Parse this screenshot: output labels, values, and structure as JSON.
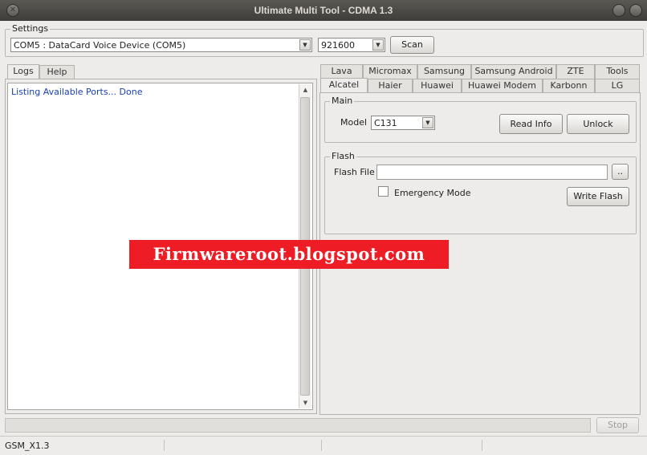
{
  "window": {
    "title": "Ultimate Multi Tool - CDMA 1.3"
  },
  "settings": {
    "group_label": "Settings",
    "port_value": "COM5 : DataCard Voice Device (COM5)",
    "baud_value": "921600",
    "scan_label": "Scan"
  },
  "left_tabs": {
    "logs": "Logs",
    "help": "Help"
  },
  "log": {
    "line1": "Listing Available Ports... Done"
  },
  "brand_tabs": {
    "row1": [
      "Lava",
      "Micromax",
      "Samsung",
      "Samsung Android",
      "ZTE",
      "Tools"
    ],
    "row2": [
      "Alcatel",
      "Haier",
      "Huawei",
      "Huawei Modem",
      "Karbonn",
      "LG"
    ],
    "active": "Alcatel"
  },
  "main": {
    "group_label": "Main",
    "model_label": "Model",
    "model_value": "C131",
    "read_info_label": "Read Info",
    "unlock_label": "Unlock"
  },
  "flash": {
    "group_label": "Flash",
    "file_label": "Flash File",
    "file_value": "",
    "browse_label": "..",
    "emergency_label": "Emergency Mode",
    "emergency_checked": false,
    "write_label": "Write Flash"
  },
  "progress": {
    "value_percent": 0
  },
  "stop_label": "Stop",
  "status": {
    "text": "GSM_X1.3"
  },
  "watermark": {
    "text": "Firmwareroot.blogspot.com"
  }
}
